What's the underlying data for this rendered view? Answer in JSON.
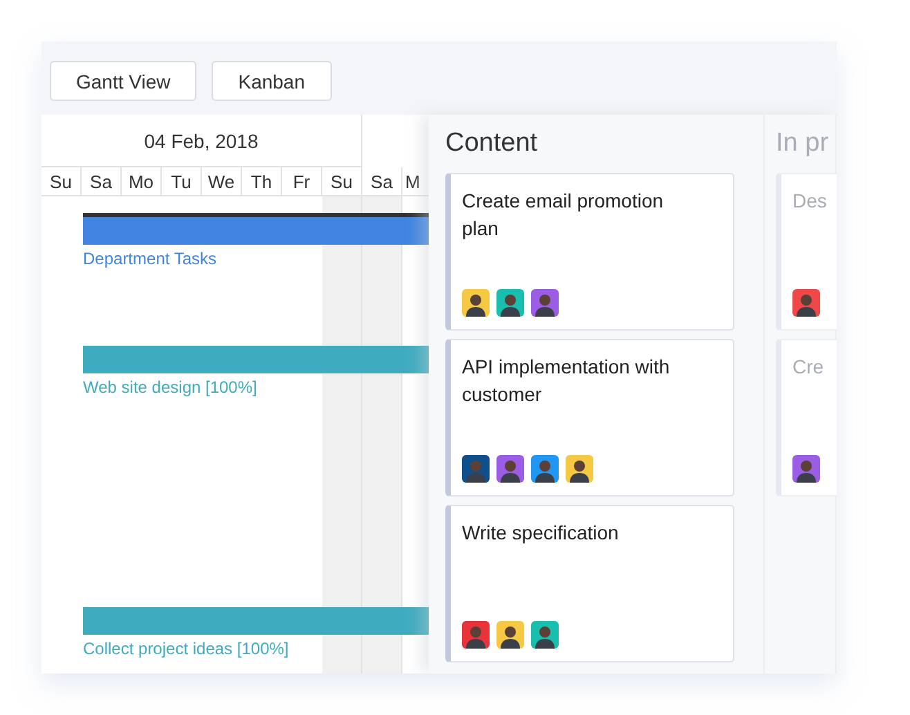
{
  "toolbar": {
    "buttons": [
      {
        "label": "Gantt View"
      },
      {
        "label": "Kanban"
      }
    ]
  },
  "gantt": {
    "period": "04 Feb, 2018",
    "days": [
      {
        "label": "Su",
        "weekend": false
      },
      {
        "label": "Sa",
        "weekend": false
      },
      {
        "label": "Mo",
        "weekend": false
      },
      {
        "label": "Tu",
        "weekend": false
      },
      {
        "label": "We",
        "weekend": false
      },
      {
        "label": "Th",
        "weekend": false
      },
      {
        "label": "Fr",
        "weekend": false
      },
      {
        "label": "Su",
        "weekend": true
      },
      {
        "label": "Sa",
        "weekend": true
      },
      {
        "label": "M",
        "weekend": false
      }
    ],
    "tasks": [
      {
        "kind": "project",
        "label": "Department Tasks",
        "color": "#4185e0"
      },
      {
        "kind": "task",
        "label": "Web site design [100%]",
        "color": "#3fabbf"
      },
      {
        "kind": "task",
        "label": "Collect project ideas [100%]",
        "color": "#3fabbf"
      }
    ]
  },
  "kanban": {
    "columns": [
      {
        "title": "Content",
        "faded": false,
        "cards": [
          {
            "title": "Create email promotion plan",
            "avatars": [
              {
                "color": "#f6c945"
              },
              {
                "color": "#18bfae"
              },
              {
                "color": "#9b5de5"
              }
            ]
          },
          {
            "title": "API implementation with customer",
            "avatars": [
              {
                "color": "#0e4f8c"
              },
              {
                "color": "#9b5de5"
              },
              {
                "color": "#2196f3"
              },
              {
                "color": "#f6c945"
              }
            ]
          },
          {
            "title": "Write specification",
            "avatars": [
              {
                "color": "#e8333a"
              },
              {
                "color": "#f6c945"
              },
              {
                "color": "#18bfae"
              }
            ]
          }
        ]
      },
      {
        "title": "In pr",
        "faded": true,
        "cards": [
          {
            "title": "Des",
            "avatars": [
              {
                "color": "#f04848"
              }
            ]
          },
          {
            "title": "Cre",
            "avatars": [
              {
                "color": "#9b5de5"
              }
            ]
          }
        ]
      }
    ]
  }
}
